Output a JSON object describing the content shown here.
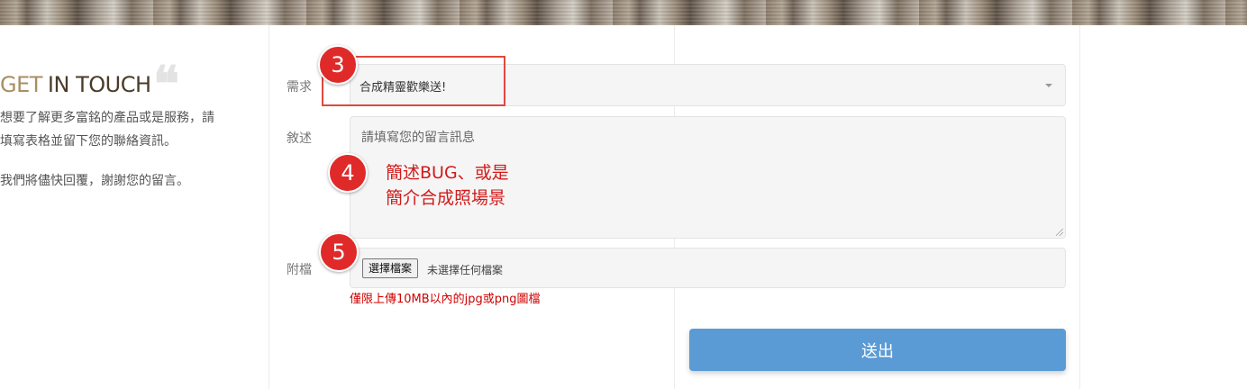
{
  "left": {
    "title_part1": "GET",
    "title_part2": "IN TOUCH",
    "quote_glyph": "❝",
    "desc_line1": "想要了解更多富銘的產品或是服務，請",
    "desc_line2": "填寫表格並留下您的聯絡資訊。",
    "desc_para2": "我們將儘快回覆，謝謝您的留言。"
  },
  "form": {
    "need_label": "需求",
    "need_value": "合成精靈歡樂送!",
    "desc_label": "敘述",
    "desc_placeholder": "請填寫您的留言訊息",
    "attach_label": "附檔",
    "file_button": "選擇檔案",
    "file_status": "未選擇任何檔案",
    "file_hint": "僅限上傳10MB以內的jpg或png圖檔",
    "submit": "送出"
  },
  "annotations": {
    "badge3": "3",
    "badge4": "4",
    "badge5": "5",
    "note_line1": "簡述BUG、或是",
    "note_line2": "簡介合成照場景"
  },
  "icons": {
    "quote": "quote-icon",
    "dropdown": "chevron-down-icon"
  },
  "colors": {
    "accent_gold": "#a88e64",
    "submit_blue": "#5b9bd5",
    "annotation_red": "#e02a2a"
  }
}
